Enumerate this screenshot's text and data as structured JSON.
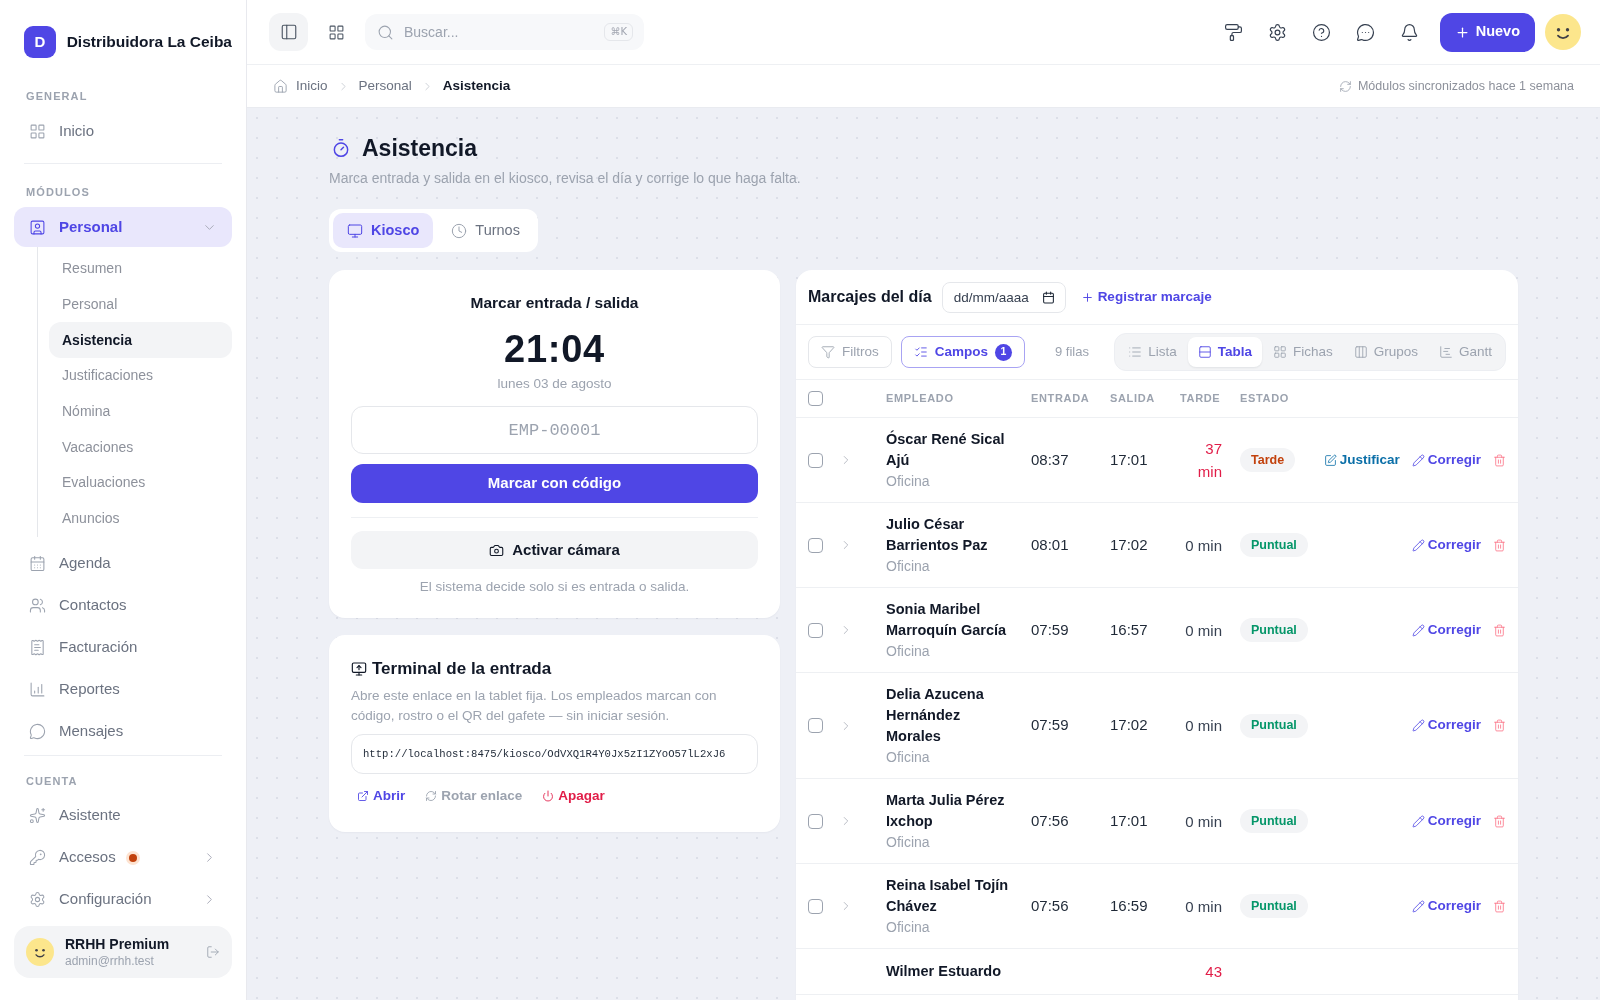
{
  "sidebar": {
    "brand": {
      "initial": "D",
      "name": "Distribuidora La Ceiba"
    },
    "sections": [
      {
        "title": "GENERAL",
        "items": [
          {
            "label": "Inicio",
            "selected": false
          }
        ]
      },
      {
        "title": "MÓDULOS",
        "items": [
          {
            "label": "Personal",
            "selected": true,
            "expanded": true,
            "children": [
              {
                "label": "Resumen",
                "selected": false
              },
              {
                "label": "Personal",
                "selected": false
              },
              {
                "label": "Asistencia",
                "selected": true
              },
              {
                "label": "Justificaciones",
                "selected": false
              },
              {
                "label": "Nómina",
                "selected": false
              },
              {
                "label": "Vacaciones",
                "selected": false
              },
              {
                "label": "Evaluaciones",
                "selected": false
              },
              {
                "label": "Anuncios",
                "selected": false
              }
            ]
          },
          {
            "label": "Agenda",
            "selected": false
          },
          {
            "label": "Contactos",
            "selected": false
          },
          {
            "label": "Facturación",
            "selected": false
          },
          {
            "label": "Reportes",
            "selected": false
          },
          {
            "label": "Mensajes",
            "selected": false
          }
        ]
      },
      {
        "title": "CUENTA",
        "items": [
          {
            "label": "Asistente",
            "selected": false,
            "dot": false
          },
          {
            "label": "Accesos",
            "selected": false,
            "expanded": false,
            "dot": true
          },
          {
            "label": "Configuración",
            "selected": false,
            "expanded": false,
            "dot": false
          }
        ]
      }
    ],
    "user": {
      "name": "RRHH Premium",
      "email": "admin@rrhh.test"
    }
  },
  "topbar": {
    "search": {
      "placeholder": "Buscar...",
      "shortcut": "⌘K"
    },
    "new_button": "Nuevo"
  },
  "breadcrumb": [
    {
      "label": "Inicio",
      "current": false
    },
    {
      "label": "Personal",
      "current": false
    },
    {
      "label": "Asistencia",
      "current": true
    }
  ],
  "sync_status": "Módulos sincronizados hace 1 semana",
  "page": {
    "title": "Asistencia",
    "subtitle": "Marca entrada y salida en el kiosco, revisa el día y corrige lo que haga falta."
  },
  "tabs": [
    {
      "label": "Kiosco",
      "selected": true
    },
    {
      "label": "Turnos",
      "selected": false
    }
  ],
  "kiosk": {
    "title": "Marcar entrada / salida",
    "time": "21:04",
    "date": "lunes 03 de agosto",
    "code_field": {
      "placeholder": "EMP-00001"
    },
    "submit_button": "Marcar con código",
    "camera_button": "Activar cámara",
    "note": "El sistema decide solo si es entrada o salida."
  },
  "terminal": {
    "title": "Terminal de la entrada",
    "description": "Abre este enlace en la tablet fija. Los empleados marcan con código, rostro o el QR del gafete — sin iniciar sesión.",
    "url": "http://localhost:8475/kiosco/OdVXQ1R4Y0Jx5zI1ZYoO57lL2xJ6",
    "actions": [
      {
        "kind": "open",
        "label": "Abrir"
      },
      {
        "kind": "rotate",
        "label": "Rotar enlace"
      },
      {
        "kind": "off",
        "label": "Apagar"
      }
    ]
  },
  "attendance": {
    "title": "Marcajes del día",
    "date_field": {
      "placeholder": "dd/mm/aaaa"
    },
    "add_link": "Registrar marcaje",
    "filters_button": "Filtros",
    "fields_button": {
      "label": "Campos",
      "count": "1",
      "active": true
    },
    "row_count": "9 filas",
    "views": [
      {
        "label": "Lista",
        "selected": false
      },
      {
        "label": "Tabla",
        "selected": true
      },
      {
        "label": "Fichas",
        "selected": false
      },
      {
        "label": "Grupos",
        "selected": false
      },
      {
        "label": "Gantt",
        "selected": false
      }
    ],
    "select_all": {
      "checked": false
    },
    "columns": [
      "EMPLEADO",
      "ENTRADA",
      "SALIDA",
      "TARDE",
      "ESTADO"
    ],
    "rows": [
      {
        "checked": false,
        "expanded": false,
        "name": "Óscar René Sical Ajú",
        "department": "Oficina",
        "in": "08:37",
        "out": "17:01",
        "late": "37 min",
        "late_alert": true,
        "status": {
          "label": "Tarde",
          "kind": "late"
        },
        "actions": [
          {
            "kind": "justify",
            "label": "Justificar"
          },
          {
            "kind": "edit",
            "label": "Corregir"
          },
          {
            "kind": "delete"
          }
        ]
      },
      {
        "checked": false,
        "expanded": false,
        "name": "Julio César Barrientos Paz",
        "department": "Oficina",
        "in": "08:01",
        "out": "17:02",
        "late": "0 min",
        "late_alert": false,
        "status": {
          "label": "Puntual",
          "kind": "on_time"
        },
        "actions": [
          {
            "kind": "edit",
            "label": "Corregir"
          },
          {
            "kind": "delete"
          }
        ]
      },
      {
        "checked": false,
        "expanded": false,
        "name": "Sonia Maribel Marroquín García",
        "department": "Oficina",
        "in": "07:59",
        "out": "16:57",
        "late": "0 min",
        "late_alert": false,
        "status": {
          "label": "Puntual",
          "kind": "on_time"
        },
        "actions": [
          {
            "kind": "edit",
            "label": "Corregir"
          },
          {
            "kind": "delete"
          }
        ]
      },
      {
        "checked": false,
        "expanded": false,
        "name": "Delia Azucena Hernández Morales",
        "department": "Oficina",
        "in": "07:59",
        "out": "17:02",
        "late": "0 min",
        "late_alert": false,
        "status": {
          "label": "Puntual",
          "kind": "on_time"
        },
        "actions": [
          {
            "kind": "edit",
            "label": "Corregir"
          },
          {
            "kind": "delete"
          }
        ]
      },
      {
        "checked": false,
        "expanded": false,
        "name": "Marta Julia Pérez Ixchop",
        "department": "Oficina",
        "in": "07:56",
        "out": "17:01",
        "late": "0 min",
        "late_alert": false,
        "status": {
          "label": "Puntual",
          "kind": "on_time"
        },
        "actions": [
          {
            "kind": "edit",
            "label": "Corregir"
          },
          {
            "kind": "delete"
          }
        ]
      },
      {
        "checked": false,
        "expanded": false,
        "name": "Reina Isabel Tojín Chávez",
        "department": "Oficina",
        "in": "07:56",
        "out": "16:59",
        "late": "0 min",
        "late_alert": false,
        "status": {
          "label": "Puntual",
          "kind": "on_time"
        },
        "actions": [
          {
            "kind": "edit",
            "label": "Corregir"
          },
          {
            "kind": "delete"
          }
        ]
      },
      {
        "name": "Wilmer Estuardo",
        "late": "43",
        "late_alert": true
      }
    ]
  }
}
